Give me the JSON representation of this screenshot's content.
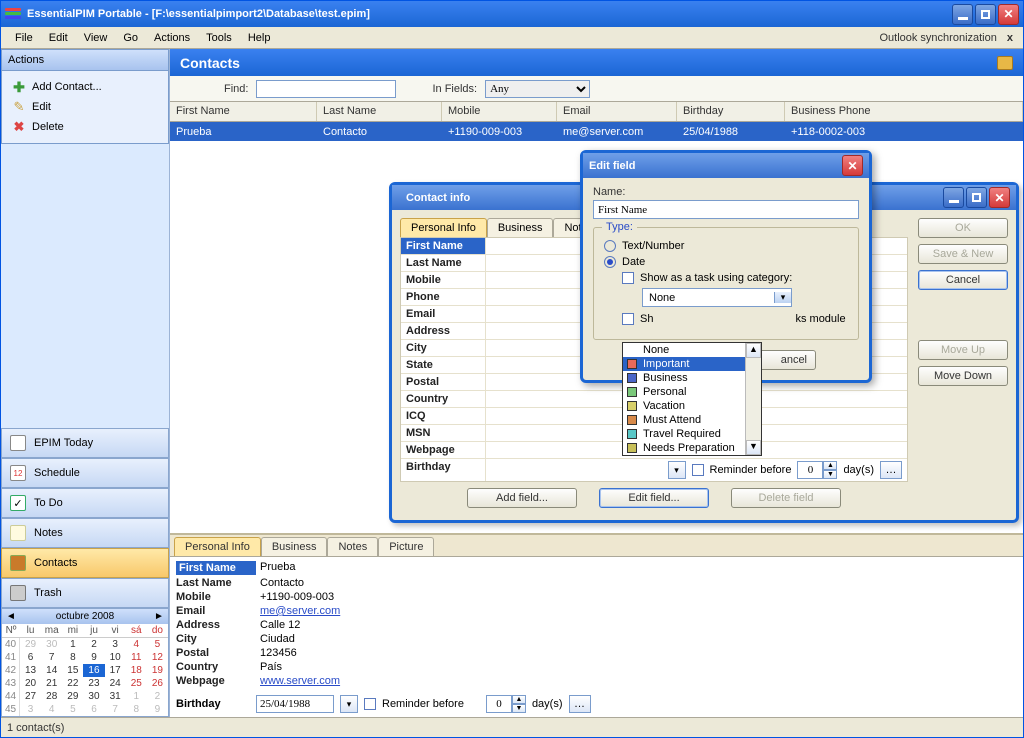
{
  "window": {
    "title": "EssentialPIM Portable - [F:\\essentialpimport2\\Database\\test.epim]"
  },
  "menubar": [
    "File",
    "Edit",
    "View",
    "Go",
    "Actions",
    "Tools",
    "Help"
  ],
  "outlook_sync_label": "Outlook synchronization",
  "actions": {
    "header": "Actions",
    "add": "Add Contact...",
    "edit": "Edit",
    "delete": "Delete"
  },
  "nav": {
    "today": "EPIM Today",
    "schedule": "Schedule",
    "todo": "To Do",
    "notes": "Notes",
    "contacts": "Contacts",
    "trash": "Trash"
  },
  "calendar": {
    "title": "octubre  2008",
    "day_headers": [
      "Nº",
      "lu",
      "ma",
      "mi",
      "ju",
      "vi",
      "sá",
      "do"
    ],
    "weeks": [
      {
        "wk": "40",
        "d": [
          "29",
          "30",
          "1",
          "2",
          "3",
          "4",
          "5"
        ],
        "other": [
          0,
          1
        ]
      },
      {
        "wk": "41",
        "d": [
          "6",
          "7",
          "8",
          "9",
          "10",
          "11",
          "12"
        ]
      },
      {
        "wk": "42",
        "d": [
          "13",
          "14",
          "15",
          "16",
          "17",
          "18",
          "19"
        ],
        "today": 3
      },
      {
        "wk": "43",
        "d": [
          "20",
          "21",
          "22",
          "23",
          "24",
          "25",
          "26"
        ]
      },
      {
        "wk": "44",
        "d": [
          "27",
          "28",
          "29",
          "30",
          "31",
          "1",
          "2"
        ],
        "other": [
          5,
          6
        ]
      },
      {
        "wk": "45",
        "d": [
          "3",
          "4",
          "5",
          "6",
          "7",
          "8",
          "9"
        ],
        "other": [
          0,
          1,
          2,
          3,
          4,
          5,
          6
        ]
      }
    ]
  },
  "panel_title": "Contacts",
  "findbar": {
    "find_label": "Find:",
    "infields_label": "In Fields:",
    "infields_value": "Any"
  },
  "columns": [
    "First Name",
    "Last Name",
    "Mobile",
    "Email",
    "Birthday",
    "Business Phone"
  ],
  "rows": [
    {
      "fn": "Prueba",
      "ln": "Contacto",
      "mob": "+1190-009-003",
      "em": "me@server.com",
      "bd": "25/04/1988",
      "bp": "+118-0002-003"
    }
  ],
  "detail": {
    "tabs": [
      "Personal Info",
      "Business",
      "Notes",
      "Picture"
    ],
    "fields": {
      "first_name_label": "First Name",
      "first_name": "Prueba",
      "last_name_label": "Last Name",
      "last_name": "Contacto",
      "mobile_label": "Mobile",
      "mobile": "+1190-009-003",
      "email_label": "Email",
      "email": "me@server.com",
      "address_label": "Address",
      "address": "Calle 12",
      "city_label": "City",
      "city": "Ciudad",
      "postal_label": "Postal",
      "postal": "123456",
      "country_label": "Country",
      "country": "País",
      "webpage_label": "Webpage",
      "webpage": "www.server.com",
      "birthday_label": "Birthday",
      "birthday": "25/04/1988"
    },
    "reminder_label": "Reminder before",
    "reminder_value": "0",
    "reminder_unit": "day(s)"
  },
  "contact_dialog": {
    "title": "Contact info",
    "tabs": [
      "Personal Info",
      "Business",
      "Notes"
    ],
    "field_labels": [
      "First Name",
      "Last Name",
      "Mobile",
      "Phone",
      "Email",
      "Address",
      "City",
      "State",
      "Postal",
      "Country",
      "ICQ",
      "MSN",
      "Webpage",
      "Birthday"
    ],
    "reminder_label": "Reminder before",
    "reminder_value": "0",
    "reminder_unit": "day(s)",
    "buttons": {
      "add": "Add field...",
      "edit": "Edit field...",
      "delete": "Delete field",
      "ok": "OK",
      "savenew": "Save & New",
      "cancel": "Cancel",
      "moveup": "Move Up",
      "movedown": "Move Down"
    }
  },
  "edit_field_dialog": {
    "title": "Edit field",
    "name_label": "Name:",
    "name_value": "First Name",
    "type_label": "Type:",
    "opt_text": "Text/Number",
    "opt_date": "Date",
    "show_task_label": "Show as a task using category:",
    "combo_value": "None",
    "partial_checkbox_prefix": "Sh",
    "partial_checkbox_suffix": "ks module",
    "cancel_btn_visible": "ancel",
    "dropdown_items": [
      {
        "label": "None",
        "swatch": null
      },
      {
        "label": "Important",
        "swatch": "#e86a5a"
      },
      {
        "label": "Business",
        "swatch": "#4a66c8"
      },
      {
        "label": "Personal",
        "swatch": "#7ac87a"
      },
      {
        "label": "Vacation",
        "swatch": "#d8d06a"
      },
      {
        "label": "Must Attend",
        "swatch": "#d88a4a"
      },
      {
        "label": "Travel Required",
        "swatch": "#5ac8c8"
      },
      {
        "label": "Needs Preparation",
        "swatch": "#c8c05a"
      }
    ],
    "dropdown_selected": "Important"
  },
  "statusbar": "1 contact(s)"
}
